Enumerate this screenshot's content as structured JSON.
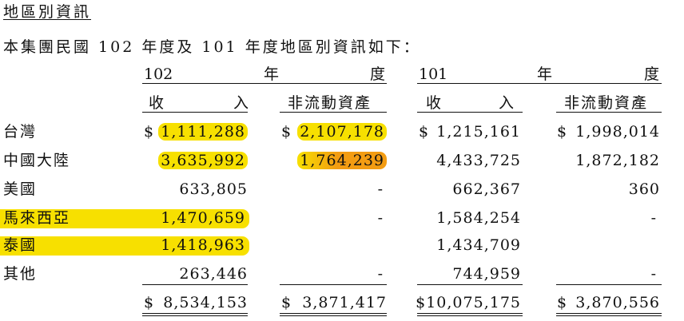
{
  "title": "地區別資訊",
  "intro": "本集團民國 102 年度及 101 年度地區別資訊如下：",
  "period_headers": [
    {
      "year": "102",
      "nian": "年",
      "du": "度"
    },
    {
      "year": "101",
      "nian": "年",
      "du": "度"
    }
  ],
  "column_headers": {
    "revenue_left": "收",
    "revenue_right": "入",
    "noncurrent_assets": "非流動資產"
  },
  "rows": [
    {
      "label": "台灣",
      "r102": "1,111,288",
      "a102": "2,107,178",
      "r101": "1,215,161",
      "a101": "1,998,014"
    },
    {
      "label": "中國大陸",
      "r102": "3,635,992",
      "a102": "1,764,239",
      "r101": "4,433,725",
      "a101": "1,872,182"
    },
    {
      "label": "美國",
      "r102": "633,805",
      "a102": "-",
      "r101": "662,367",
      "a101": "360"
    },
    {
      "label": "馬來西亞",
      "r102": "1,470,659",
      "a102": "-",
      "r101": "1,584,254",
      "a101": "-"
    },
    {
      "label": "泰國",
      "r102": "1,418,963",
      "a102": "",
      "r101": "1,434,709",
      "a101": ""
    },
    {
      "label": "其他",
      "r102": "263,446",
      "a102": "-",
      "r101": "744,959",
      "a101": "-"
    }
  ],
  "currency_symbol": "$",
  "totals": {
    "r102": "8,534,153",
    "a102": "3,871,417",
    "r101": "$10,075,175",
    "a101": "3,870,556"
  },
  "highlight_colors": {
    "yellow": "#f7e000",
    "orange": "#f39c12"
  }
}
